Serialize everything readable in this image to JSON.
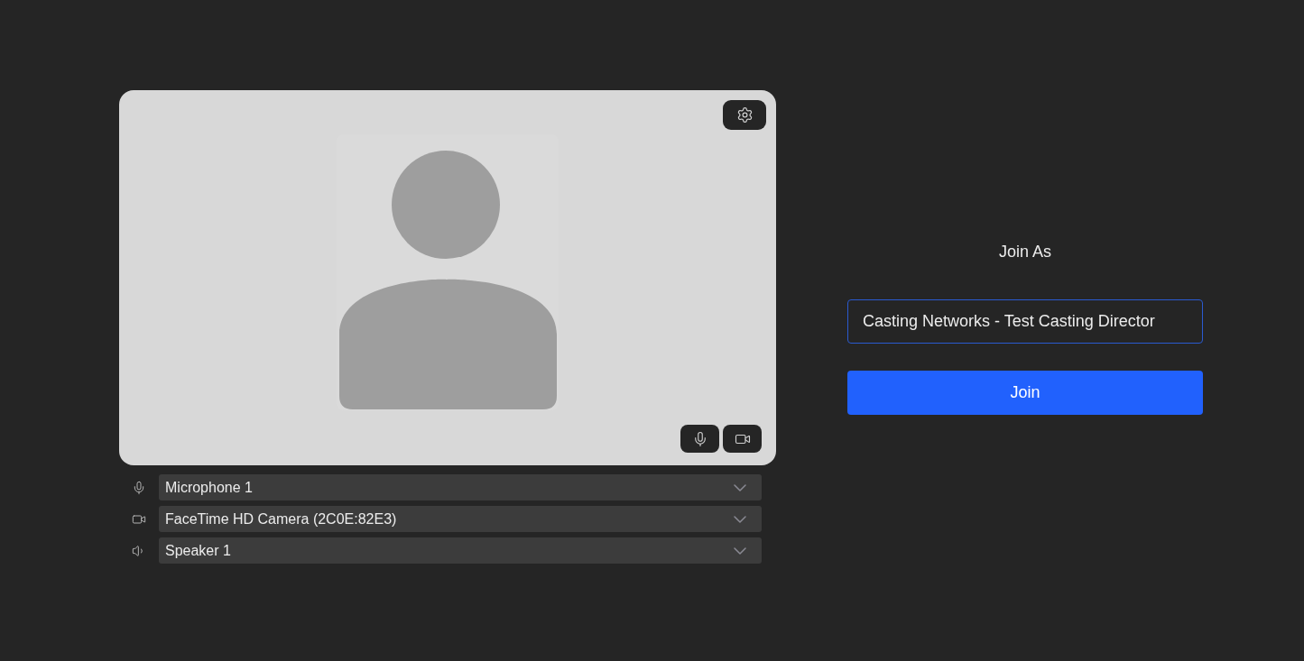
{
  "preview": {
    "controls": [
      {
        "kind": "mic"
      },
      {
        "kind": "camera"
      }
    ]
  },
  "devices": [
    {
      "kind": "mic",
      "value": "Microphone 1"
    },
    {
      "kind": "camera",
      "value": "FaceTime HD Camera (2C0E:82E3)"
    },
    {
      "kind": "speaker",
      "value": "Speaker 1"
    }
  ],
  "join": {
    "heading": "Join As",
    "name_value": "Casting Networks - Test Casting Director",
    "button": "Join"
  }
}
